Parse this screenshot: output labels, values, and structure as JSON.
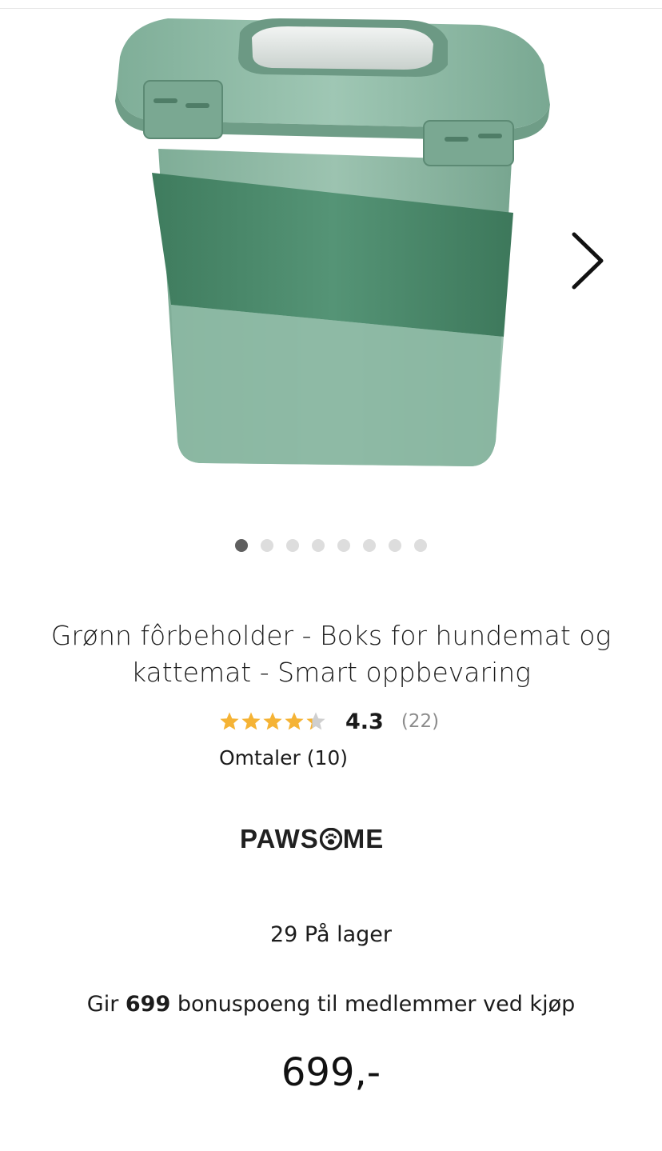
{
  "product": {
    "title": "Grønn fôrbeholder - Boks for hundemat og kattemat - Smart oppbevaring",
    "rating_value": "4.3",
    "rating_count": "(22)",
    "rating_score": 4.3,
    "reviews_label": "Omtaler (10)",
    "brand_prefix": "PAWS",
    "brand_suffix": "ME",
    "stock": "29 På lager",
    "bonus_prefix": "Gir ",
    "bonus_points": "699",
    "bonus_suffix": " bonuspoeng til medlemmer ved kjøp",
    "price": "699,-"
  },
  "carousel": {
    "image_count": 8,
    "active_index": 0
  },
  "colors": {
    "star": "#f5b335",
    "product_green_light": "#8fbba6",
    "product_green_dark": "#4f8b6c"
  }
}
